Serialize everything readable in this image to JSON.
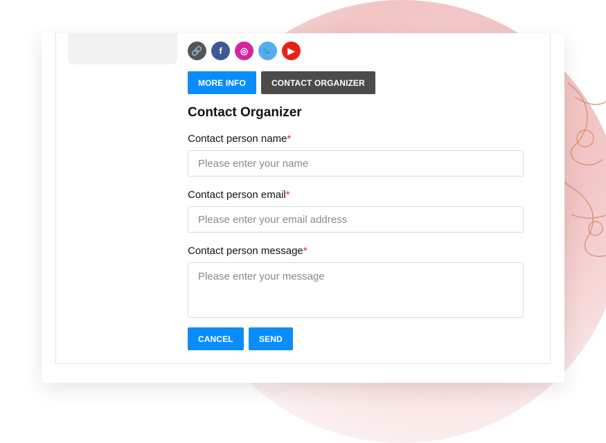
{
  "social_icons": [
    {
      "name": "link-icon",
      "glyph": "🔗",
      "color": "#555555"
    },
    {
      "name": "facebook-icon",
      "glyph": "f",
      "color": "#3b5998"
    },
    {
      "name": "instagram-icon",
      "glyph": "◎",
      "color": "#d6249f"
    },
    {
      "name": "twitter-icon",
      "glyph": "🐦",
      "color": "#55acee"
    },
    {
      "name": "youtube-icon",
      "glyph": "▶",
      "color": "#e62117"
    }
  ],
  "buttons": {
    "more_info": "MORE INFO",
    "contact_organizer": "CONTACT ORGANIZER",
    "cancel": "CANCEL",
    "send": "SEND"
  },
  "form": {
    "title": "Contact Organizer",
    "name_label": "Contact person name",
    "name_placeholder": "Please enter your name",
    "email_label": "Contact person email",
    "email_placeholder": "Please enter your email address",
    "message_label": "Contact person message",
    "message_placeholder": "Please enter your message",
    "required_marker": "*"
  },
  "colors": {
    "primary": "#0a8dfb",
    "secondary": "#4b4b4b",
    "required": "#e52222"
  }
}
